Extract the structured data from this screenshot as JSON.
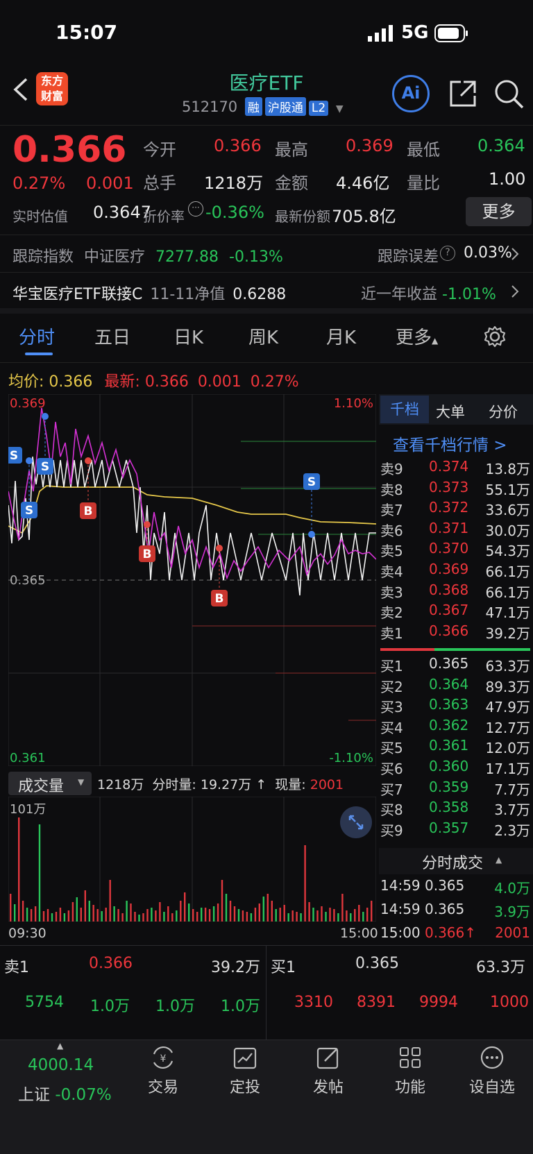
{
  "status": {
    "time": "15:07",
    "network": "5G"
  },
  "header": {
    "logo_line1": "东方",
    "logo_line2": "财富",
    "title": "医疗ETF",
    "code": "512170",
    "tags": [
      "融",
      "沪股通",
      "L2"
    ],
    "ai_label": "Ai"
  },
  "quote": {
    "price": "0.366",
    "pct": "0.27%",
    "chg": "0.001",
    "open_label": "今开",
    "open": "0.366",
    "high_label": "最高",
    "high": "0.369",
    "low_label": "最低",
    "low": "0.364",
    "vol_label": "总手",
    "vol": "1218万",
    "amt_label": "金额",
    "amt": "4.46亿",
    "ratio_label": "量比",
    "ratio": "1.00",
    "est_label": "实时估值",
    "est": "0.3647",
    "prem_label": "折价率",
    "prem": "-0.36%",
    "share_label": "最新份额",
    "share": "705.8亿",
    "more": "更多"
  },
  "tracking": {
    "label": "跟踪指数",
    "index": "中证医疗",
    "value": "7277.88",
    "pct": "-0.13%",
    "err_label": "跟踪误差",
    "err": "0.03%"
  },
  "linked": {
    "name": "华宝医疗ETF联接C",
    "nav_label": "11-11净值",
    "nav": "0.6288",
    "ret_label": "近一年收益",
    "ret": "-1.01%"
  },
  "tabs": [
    "分时",
    "五日",
    "日K",
    "周K",
    "月K",
    "更多"
  ],
  "chart_info": {
    "avg_label": "均价:",
    "avg": "0.366",
    "last_label": "最新:",
    "last": "0.366",
    "chg": "0.001",
    "pct": "0.27%"
  },
  "chart_axis": {
    "top": "0.369",
    "mid": "0.365",
    "bottom": "0.361",
    "top_pct": "1.10%",
    "bottom_pct": "-1.10%",
    "start": "09:30",
    "end": "15:00",
    "vol_top": "101万"
  },
  "volume_bar": {
    "label": "成交量",
    "vol": "1218万",
    "tick_label": "分时量:",
    "tick": "19.27万",
    "arrow": "↑",
    "now_label": "现量:",
    "now": "2001"
  },
  "markers": {
    "buy": "B",
    "sell": "S"
  },
  "side_tabs": [
    "千档",
    "大单",
    "分价"
  ],
  "view_all": "查看千档行情 >",
  "asks": [
    [
      "卖9",
      "0.374",
      "13.8万"
    ],
    [
      "卖8",
      "0.373",
      "55.1万"
    ],
    [
      "卖7",
      "0.372",
      "33.6万"
    ],
    [
      "卖6",
      "0.371",
      "30.0万"
    ],
    [
      "卖5",
      "0.370",
      "54.3万"
    ],
    [
      "卖4",
      "0.369",
      "66.1万"
    ],
    [
      "卖3",
      "0.368",
      "66.1万"
    ],
    [
      "卖2",
      "0.367",
      "47.1万"
    ],
    [
      "卖1",
      "0.366",
      "39.2万"
    ]
  ],
  "bids": [
    [
      "买1",
      "0.365",
      "63.3万"
    ],
    [
      "买2",
      "0.364",
      "89.3万"
    ],
    [
      "买3",
      "0.363",
      "47.9万"
    ],
    [
      "买4",
      "0.362",
      "12.7万"
    ],
    [
      "买5",
      "0.361",
      "12.0万"
    ],
    [
      "买6",
      "0.360",
      "17.1万"
    ],
    [
      "买7",
      "0.359",
      "7.7万"
    ],
    [
      "买8",
      "0.358",
      "3.7万"
    ],
    [
      "买9",
      "0.357",
      "2.3万"
    ]
  ],
  "ticks_title": "分时成交",
  "ticks": [
    [
      "14:59",
      "0.365",
      "4.0万"
    ],
    [
      "14:59",
      "0.365",
      "3.9万"
    ],
    [
      "15:00",
      "0.366↑",
      "2001"
    ]
  ],
  "bottom_book": {
    "sell_label": "卖1",
    "sell_price": "0.366",
    "sell_vol": "39.2万",
    "buy_label": "买1",
    "buy_price": "0.365",
    "buy_vol": "63.3万",
    "sell_row": [
      "5754",
      "1.0万",
      "1.0万",
      "1.0万"
    ],
    "buy_row": [
      "3310",
      "8391",
      "9994",
      "1000"
    ]
  },
  "footer": {
    "index_value": "4000.14",
    "index_name": "上证",
    "index_pct": "-0.07%",
    "items": [
      "交易",
      "定投",
      "发帖",
      "功能",
      "设自选"
    ]
  },
  "colors": {
    "up": "#f0363c",
    "down": "#29c55a",
    "price_line": "#ffffff",
    "avg_line": "#e6c84a",
    "accent": "#4f8ff7"
  }
}
